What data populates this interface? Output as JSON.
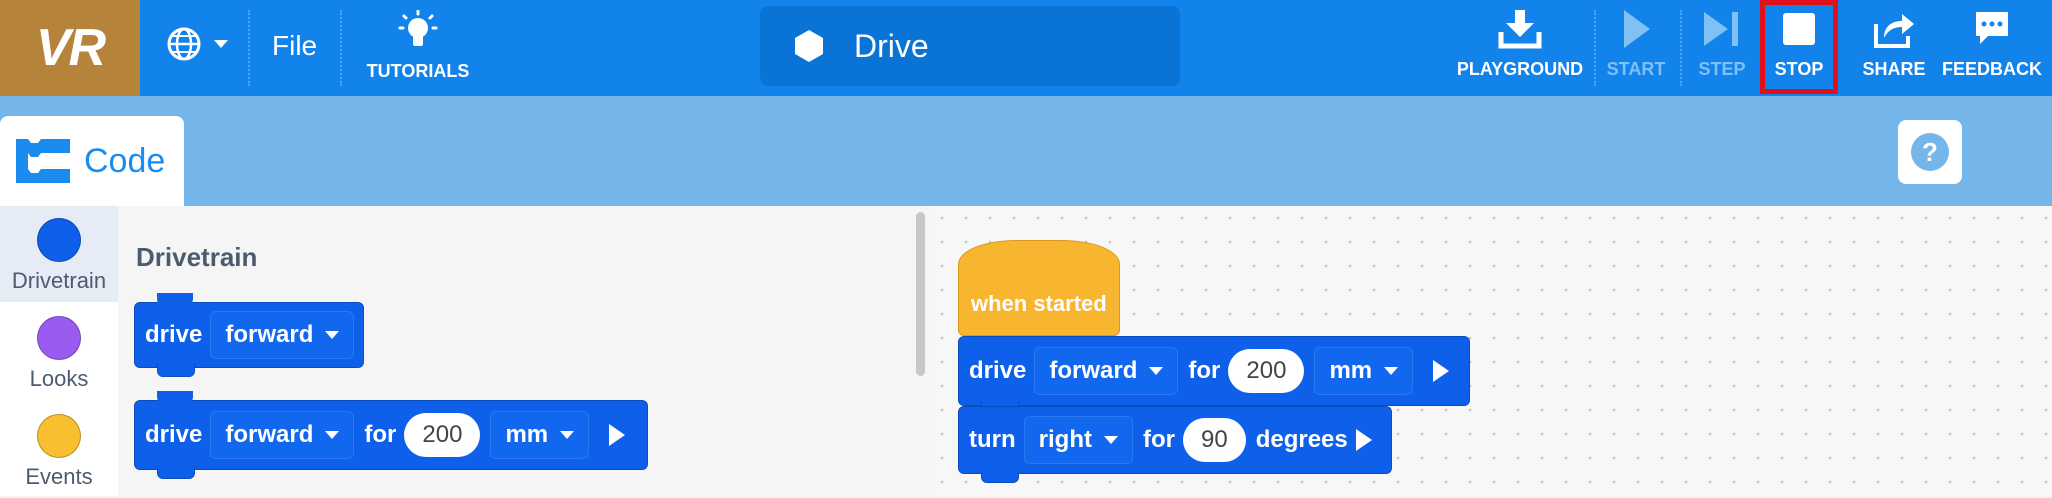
{
  "app": {
    "logo": "VR",
    "file_label": "File",
    "tutorials_label": "TUTORIALS",
    "project_name": "Drive"
  },
  "toolbar": {
    "playground": "PLAYGROUND",
    "start": "START",
    "step": "STEP",
    "stop": "STOP",
    "share": "SHARE",
    "feedback": "FEEDBACK"
  },
  "tabs": {
    "code": "Code"
  },
  "categories": [
    {
      "name": "Drivetrain",
      "color": "#0e60ea"
    },
    {
      "name": "Looks",
      "color": "#9a5cf0"
    },
    {
      "name": "Events",
      "color": "#f8c030"
    }
  ],
  "palette": {
    "title": "Drivetrain",
    "block1": {
      "verb": "drive",
      "dir": "forward"
    },
    "block2": {
      "verb": "drive",
      "dir": "forward",
      "for": "for",
      "value": "200",
      "unit": "mm"
    }
  },
  "workspace": {
    "hat": "when started",
    "drive": {
      "verb": "drive",
      "dir": "forward",
      "for": "for",
      "value": "200",
      "unit": "mm"
    },
    "turn": {
      "verb": "turn",
      "dir": "right",
      "for": "for",
      "value": "90",
      "unit": "degrees"
    }
  },
  "colors": {
    "topbar": "#1183ea",
    "subbar": "#74b5ea",
    "logo_bg": "#b5843a",
    "motion_block": "#0e60ea",
    "event_block": "#f8b530",
    "stop_highlight": "#e1101a"
  }
}
